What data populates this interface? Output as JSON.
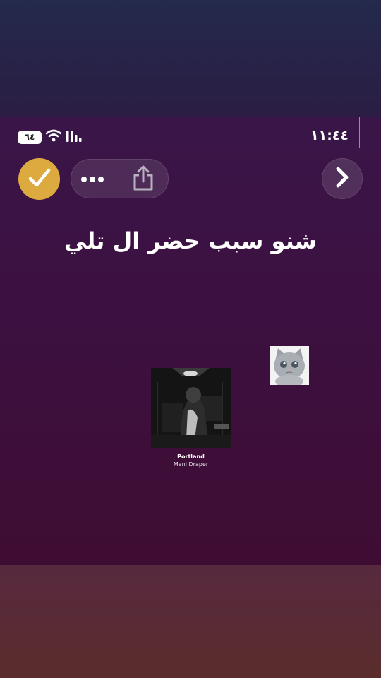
{
  "status_bar": {
    "time": "١١:٤٤",
    "battery_level": "٦٤",
    "wifi_icon": "wifi-icon",
    "signal_icon": "signal-bars-icon"
  },
  "controls": {
    "check_icon": "checkmark-icon",
    "more_icon": "more-dots-icon",
    "share_icon": "share-icon",
    "next_icon": "chevron-right-icon"
  },
  "story": {
    "caption": "شنو سبب حضر ال تلي",
    "sticker_icon": "crying-cat-sticker"
  },
  "music": {
    "title": "Portland",
    "artist": "Mani Draper"
  },
  "colors": {
    "check_accent": "#dcaa3e",
    "story_bg": "#3c1040"
  }
}
